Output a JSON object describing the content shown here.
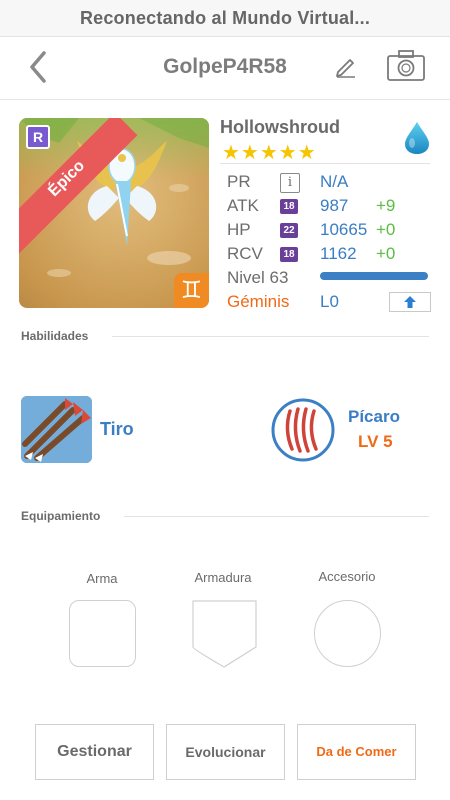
{
  "status_bar": {
    "text": "Reconectando al Mundo Virtual..."
  },
  "header": {
    "title": "GolpeP4R58",
    "back_icon": "chevron-left-icon",
    "edit_icon": "pencil-icon",
    "camera_icon": "camera-icon"
  },
  "card": {
    "rank": "R",
    "rarity": "Épico",
    "zodiac_glyph": "♊"
  },
  "monster": {
    "name": "Hollowshroud",
    "stars": "★★★★★",
    "element_icon": "water-drop-icon",
    "stats": {
      "pr": {
        "label": "PR",
        "info": "i",
        "value": "N/A"
      },
      "atk": {
        "label": "ATK",
        "badge": "18",
        "value": "987",
        "plus": "+9"
      },
      "hp": {
        "label": "HP",
        "badge": "22",
        "value": "10665",
        "plus": "+0"
      },
      "rcv": {
        "label": "RCV",
        "badge": "18",
        "value": "1162",
        "plus": "+0"
      }
    },
    "level": {
      "label": "Nivel 63",
      "progress": 1.0
    },
    "sign": {
      "label": "Géminis",
      "value": "L0"
    }
  },
  "skills": {
    "section_title": "Habilidades",
    "active": {
      "name": "Tiro",
      "icon": "arrows-icon"
    },
    "trait": {
      "name": "Pícaro",
      "level": "LV 5",
      "icon": "claw-icon"
    }
  },
  "equipment": {
    "section_title": "Equipamiento",
    "slots": [
      {
        "label": "Arma"
      },
      {
        "label": "Armadura"
      },
      {
        "label": "Accesorio"
      }
    ]
  },
  "actions": {
    "manage": "Gestionar",
    "evolve": "Evolucionar",
    "feed": "Da de Comer"
  },
  "colors": {
    "accent_blue": "#3b7fc4",
    "accent_orange": "#f06a16",
    "epic_red": "#e85a5a",
    "plus_green": "#5bbd43"
  }
}
